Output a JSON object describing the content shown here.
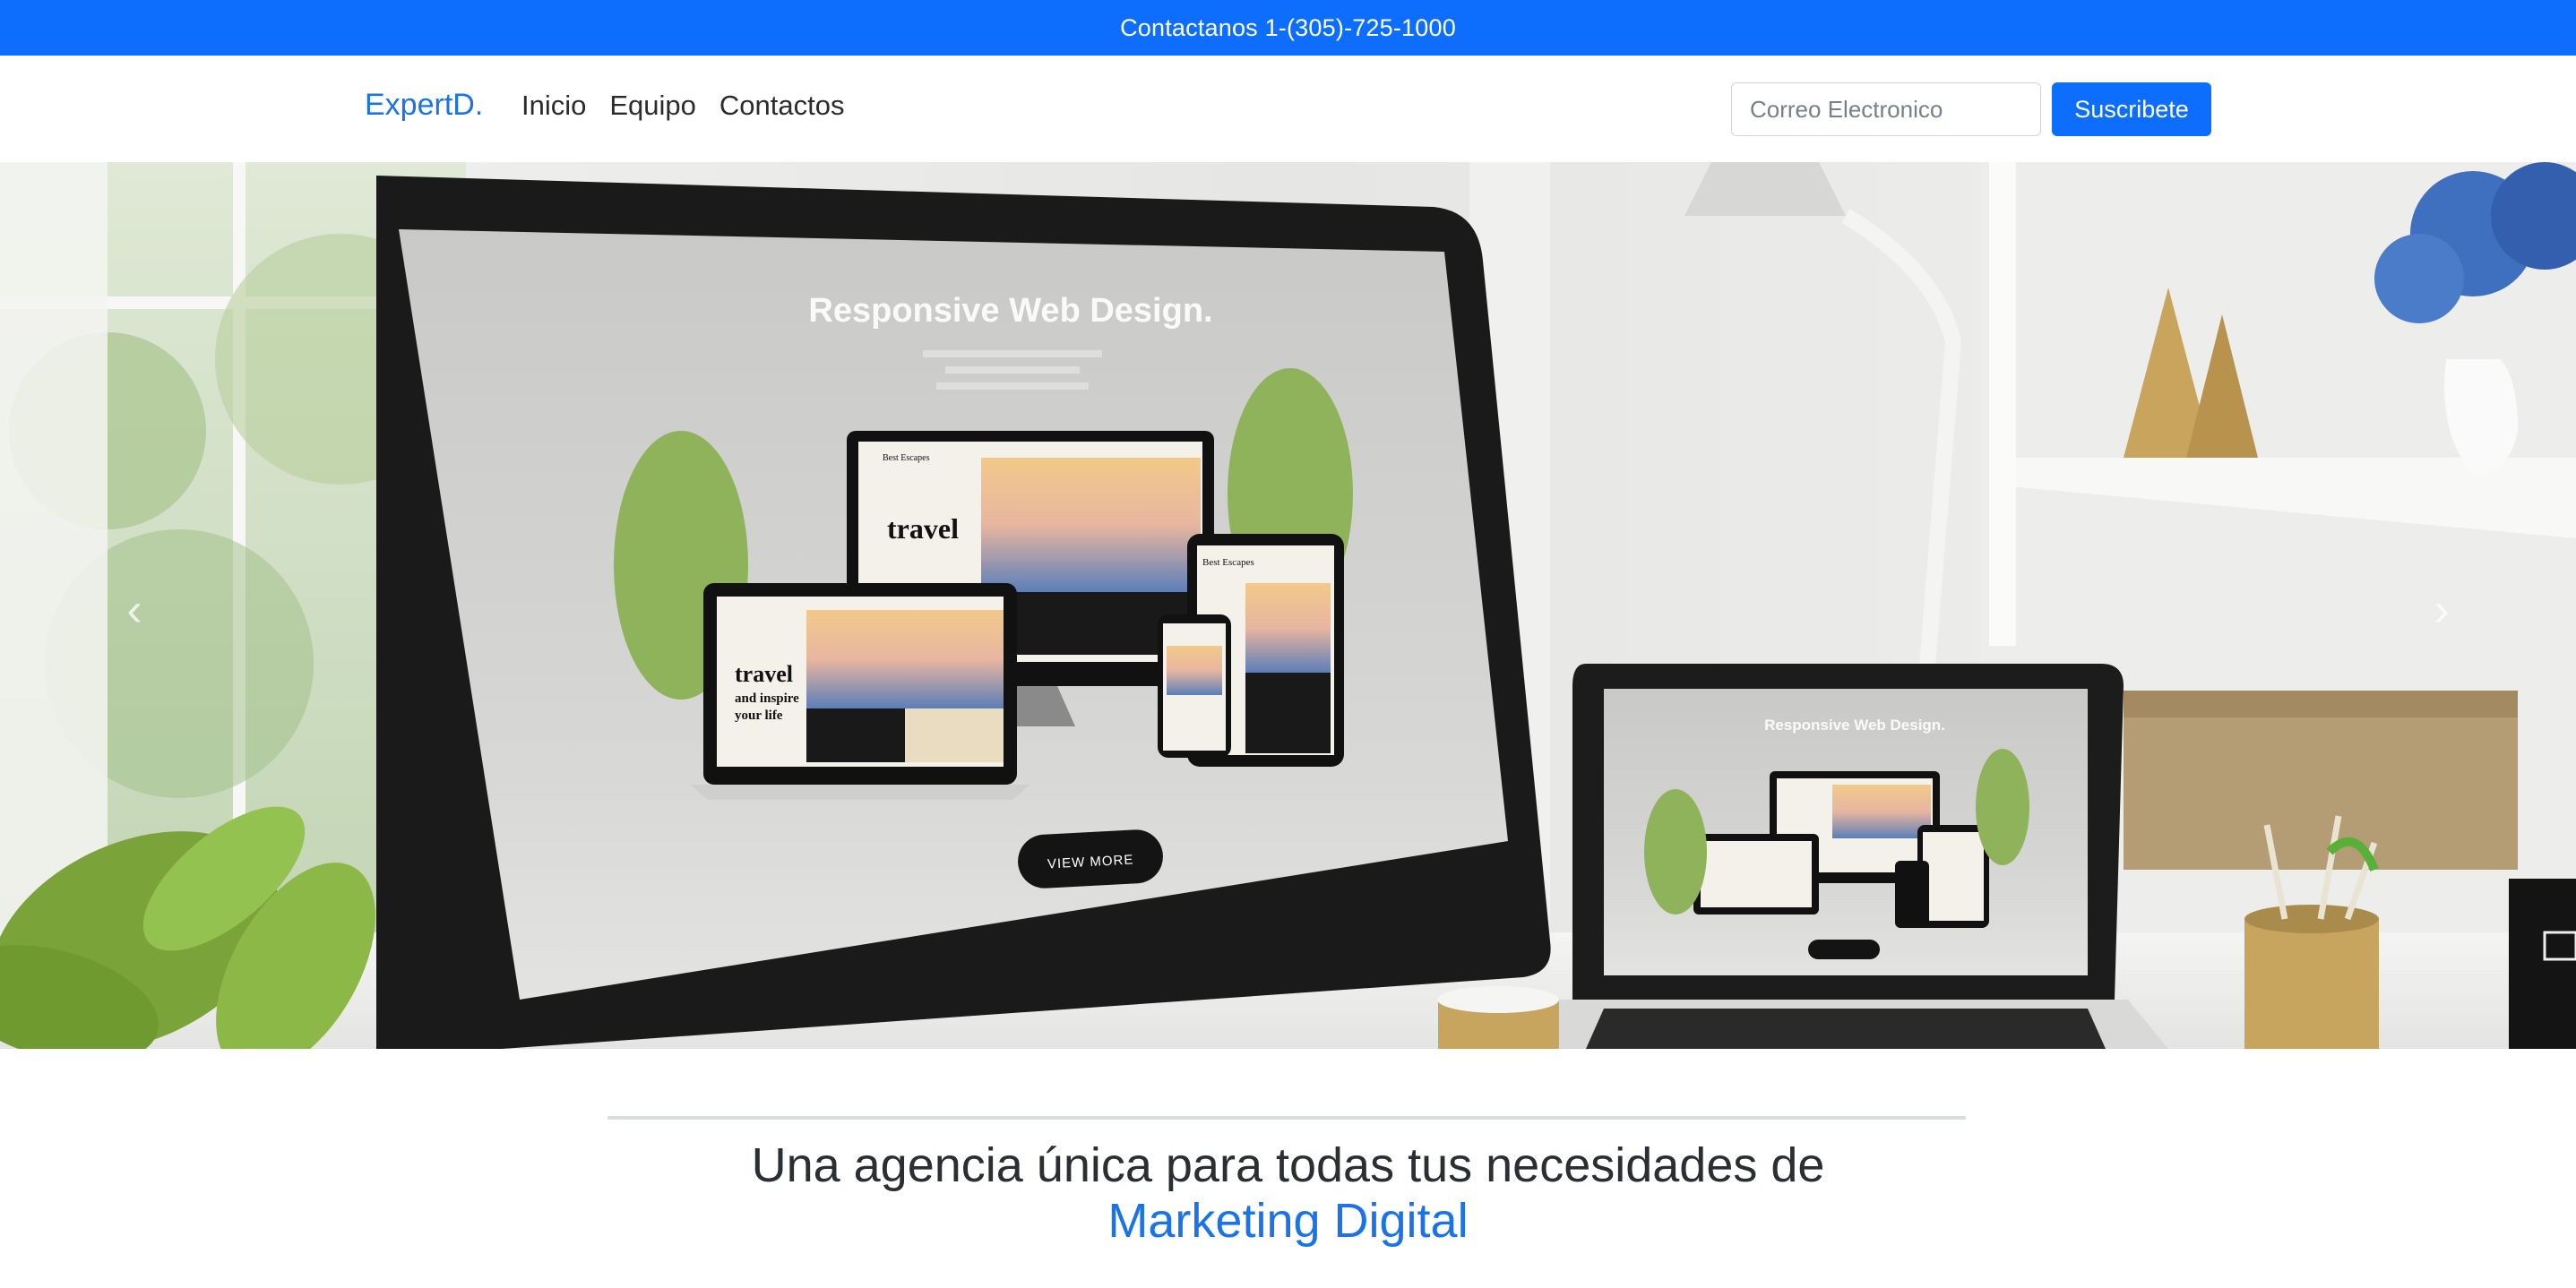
{
  "topbar": {
    "contact_text": "Contactanos 1-(305)-725-1000",
    "bg_color": "#0d6efd"
  },
  "navbar": {
    "brand": "ExpertD.",
    "links": [
      {
        "label": "Inicio"
      },
      {
        "label": "Equipo"
      },
      {
        "label": "Contactos"
      }
    ],
    "email_placeholder": "Correo Electronico",
    "subscribe_label": "Suscribete"
  },
  "hero": {
    "screen_title": "Responsive Web Design.",
    "cta_label": "VIEW MORE",
    "device_text_1": "travel",
    "device_text_2": "and inspire",
    "device_text_3": "your life",
    "brand_small": "Best Escapes",
    "prev_icon": "chevron-left-icon",
    "next_icon": "chevron-right-icon"
  },
  "intro": {
    "line1": "Una agencia única para todas tus necesidades de",
    "line2": "Marketing Digital",
    "accent_color": "#1a73e8"
  }
}
